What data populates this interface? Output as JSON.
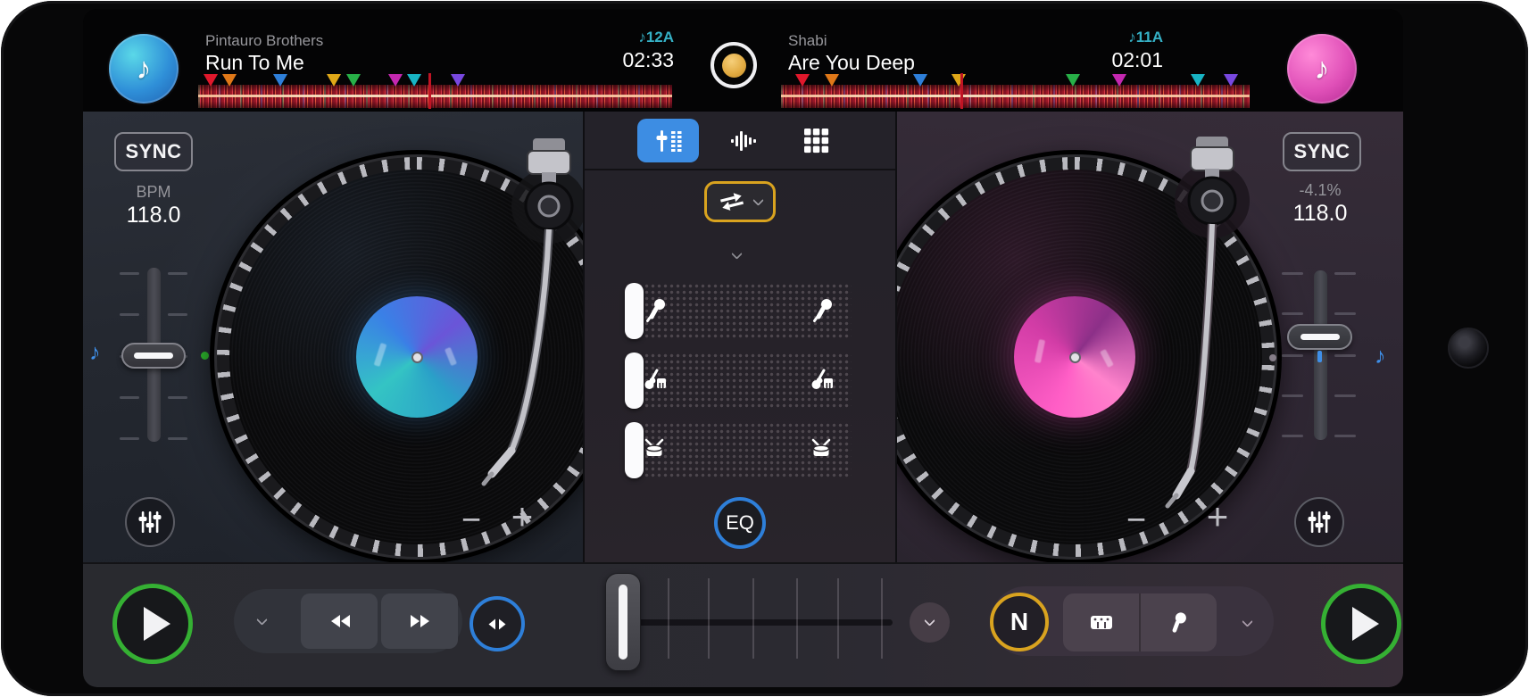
{
  "top_bar": {
    "record_button": {
      "state": "recording"
    },
    "deck_a": {
      "artist": "Pintauro Brothers",
      "title": "Run To Me",
      "key": "12A",
      "time": "02:33",
      "playhead_pos": 48.6,
      "cues": [
        {
          "color": "#e0182c",
          "pos": 2.6
        },
        {
          "color": "#e07818",
          "pos": 6.6
        },
        {
          "color": "#2e7fd9",
          "pos": 17.3
        },
        {
          "color": "#e0a818",
          "pos": 28.6
        },
        {
          "color": "#28b048",
          "pos": 32.8
        },
        {
          "color": "#c428b0",
          "pos": 41.6
        },
        {
          "color": "#18b4c4",
          "pos": 45.6
        },
        {
          "color": "#7848e0",
          "pos": 54.8
        }
      ]
    },
    "deck_b": {
      "artist": "Shabi",
      "title": "Are You Deep",
      "key": "11A",
      "time": "02:01",
      "playhead_pos": 38.3,
      "cues": [
        {
          "color": "#e0182c",
          "pos": 4.6
        },
        {
          "color": "#e07818",
          "pos": 10.9
        },
        {
          "color": "#2e7fd9",
          "pos": 29.7
        },
        {
          "color": "#e0a818",
          "pos": 37.9
        },
        {
          "color": "#28b048",
          "pos": 62.3
        },
        {
          "color": "#c428b0",
          "pos": 72.2
        },
        {
          "color": "#18b4c4",
          "pos": 88.9
        },
        {
          "color": "#7848e0",
          "pos": 96.0
        }
      ]
    }
  },
  "deck_a": {
    "sync": "SYNC",
    "bpm_label": "BPM",
    "bpm": "118.0",
    "minus": "−",
    "plus": "+"
  },
  "deck_b": {
    "sync": "SYNC",
    "tempo_offset": "-4.1%",
    "bpm": "118.0",
    "minus": "−",
    "plus": "+"
  },
  "mixer": {
    "eq": "EQ",
    "tabs": [
      {
        "name": "mixer-view"
      },
      {
        "name": "waveform-view"
      },
      {
        "name": "pads-view"
      }
    ],
    "stems": [
      {
        "icon": "vocals-microphone"
      },
      {
        "icon": "instruments"
      },
      {
        "icon": "drums"
      }
    ]
  },
  "bottom_bar": {
    "neural_mix": "N"
  },
  "icons": {
    "music_note": "♪"
  },
  "colors": {
    "accent_blue": "#2e7fd9",
    "accent_gold": "#d9a31f",
    "accent_green": "#35b033",
    "key_teal": "#35b0c5"
  }
}
